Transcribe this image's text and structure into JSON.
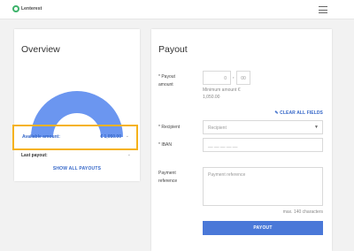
{
  "header": {
    "brand": "Lenterest",
    "menu_icon": "hamburger-menu-icon"
  },
  "overview": {
    "title": "Overview",
    "gauge_fill": 1.0,
    "available_label": "Available amount:",
    "available_value": "€ 1,050.00",
    "last_payout_label": "Last payout:",
    "show_all_label": "SHOW ALL PAYOUTS"
  },
  "payout": {
    "title": "Payout",
    "amount_label": "* Payout amount",
    "amount_value": "0",
    "amount_decimal_separator": ",",
    "amount_cents": "00",
    "min_amount_hint": "Minimum amount € 1,050.00",
    "clear_all_label": "CLEAR ALL FIELDS",
    "recipient_label": "* Recipient",
    "recipient_placeholder": "Recipient",
    "iban_label": "* IBAN",
    "iban_placeholder": "__ __ __ __ __",
    "reference_label": "Payment reference",
    "reference_placeholder": "Payment reference",
    "max_chars_hint": "max. 140 characters",
    "submit_label": "PAYOUT"
  },
  "colors": {
    "accent": "#4a78d8",
    "link": "#3567c8",
    "highlight": "#f5b21a",
    "brand": "#3db36b"
  }
}
